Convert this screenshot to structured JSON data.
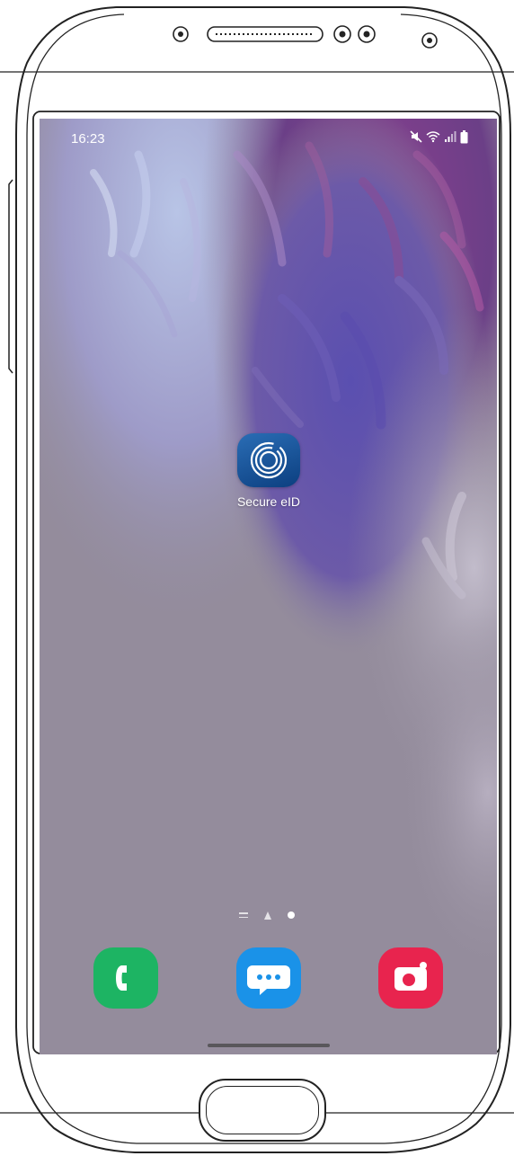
{
  "status_bar": {
    "time": "16:23",
    "icons": [
      "mute-icon",
      "wifi-icon",
      "signal-icon",
      "battery-icon"
    ]
  },
  "home_screen": {
    "apps": [
      {
        "label": "Secure eID",
        "icon": "secure-eid-icon"
      }
    ],
    "page_indicator": {
      "pages": 2,
      "current_page": 2
    }
  },
  "dock": [
    {
      "icon": "phone-icon",
      "color": "#1db463"
    },
    {
      "icon": "messages-icon",
      "color": "#1a92e8"
    },
    {
      "icon": "camera-icon",
      "color": "#e8244e"
    }
  ],
  "colors": {
    "wallpaper_base": "#948c9c",
    "secure_eid_bg": "#1a5aa3"
  }
}
